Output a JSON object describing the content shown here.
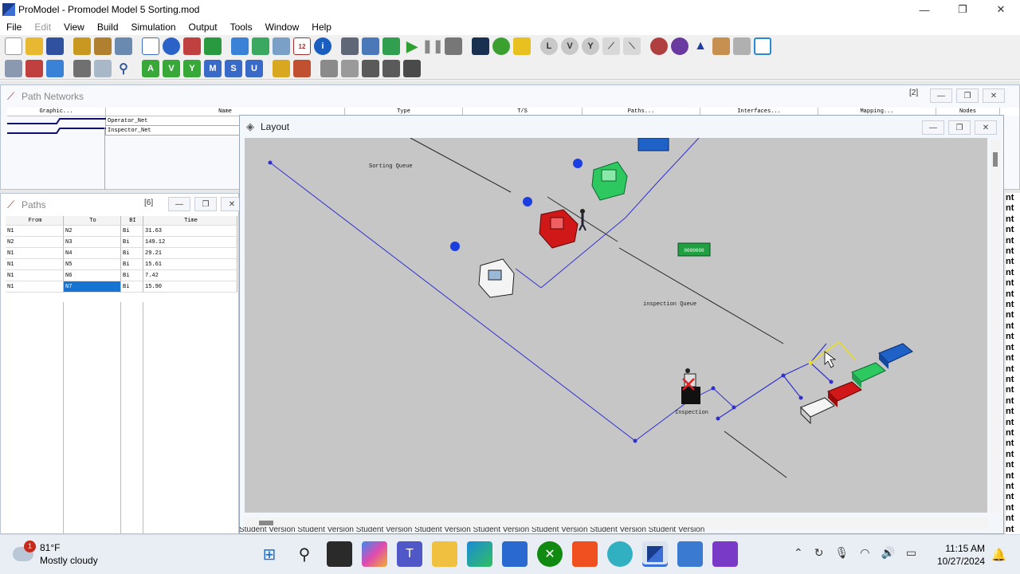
{
  "app": {
    "title": "ProModel - Promodel Model 5 Sorting.mod",
    "minimize": "—",
    "maximize": "❐",
    "close": "✕"
  },
  "menu": [
    "File",
    "Edit",
    "View",
    "Build",
    "Simulation",
    "Output",
    "Tools",
    "Window",
    "Help"
  ],
  "toolbar2_labels": {
    "a": "A",
    "v": "V",
    "y": "Y",
    "m": "M",
    "s": "S",
    "u": "U"
  },
  "path_networks": {
    "title": "Path Networks",
    "badge": "[2]",
    "columns": [
      "Graphic...",
      "Name",
      "Type",
      "T/S",
      "Paths...",
      "Interfaces...",
      "Mapping...",
      "Nodes"
    ],
    "rows": [
      {
        "name": "Operator_Net"
      },
      {
        "name": "Inspector_Net"
      }
    ]
  },
  "paths": {
    "title": "Paths",
    "badge": "[6]",
    "columns": [
      "From",
      "To",
      "BI",
      "Time"
    ],
    "rows": [
      {
        "from": "N1",
        "to": "N2",
        "bi": "Bi",
        "time": "31.63"
      },
      {
        "from": "N2",
        "to": "N3",
        "bi": "Bi",
        "time": "149.12"
      },
      {
        "from": "N1",
        "to": "N4",
        "bi": "Bi",
        "time": "29.21"
      },
      {
        "from": "N1",
        "to": "N5",
        "bi": "Bi",
        "time": "15.61"
      },
      {
        "from": "N1",
        "to": "N6",
        "bi": "Bi",
        "time": "7.42"
      },
      {
        "from": "N1",
        "to": "N7",
        "bi": "Bi",
        "time": "15.90"
      }
    ]
  },
  "layout": {
    "title": "Layout",
    "labels": {
      "sorting_queue": "Sorting Queue",
      "inspection_queue": "inspection Queue",
      "inspection": "Inspection",
      "counter": "0000000"
    }
  },
  "watermark": "Student Version Student Version Student Version Student Version Student Version Student Version Student Version Student Version",
  "right_strip": "nt nt nt nt nt nt nt nt nt nt nt nt nt nt nt nt nt nt nt nt nt nt nt nt nt nt nt nt nt nt nt nt",
  "taskbar": {
    "weather_temp": "81°F",
    "weather_desc": "Mostly cloudy",
    "weather_badge": "1",
    "time": "11:15 AM",
    "date": "10/27/2024"
  },
  "colors": {
    "accent": "#1874d2",
    "path_line": "#3030d0",
    "machine_red": "#d01818",
    "machine_green": "#2ec860",
    "machine_blue": "#1e62c8"
  }
}
